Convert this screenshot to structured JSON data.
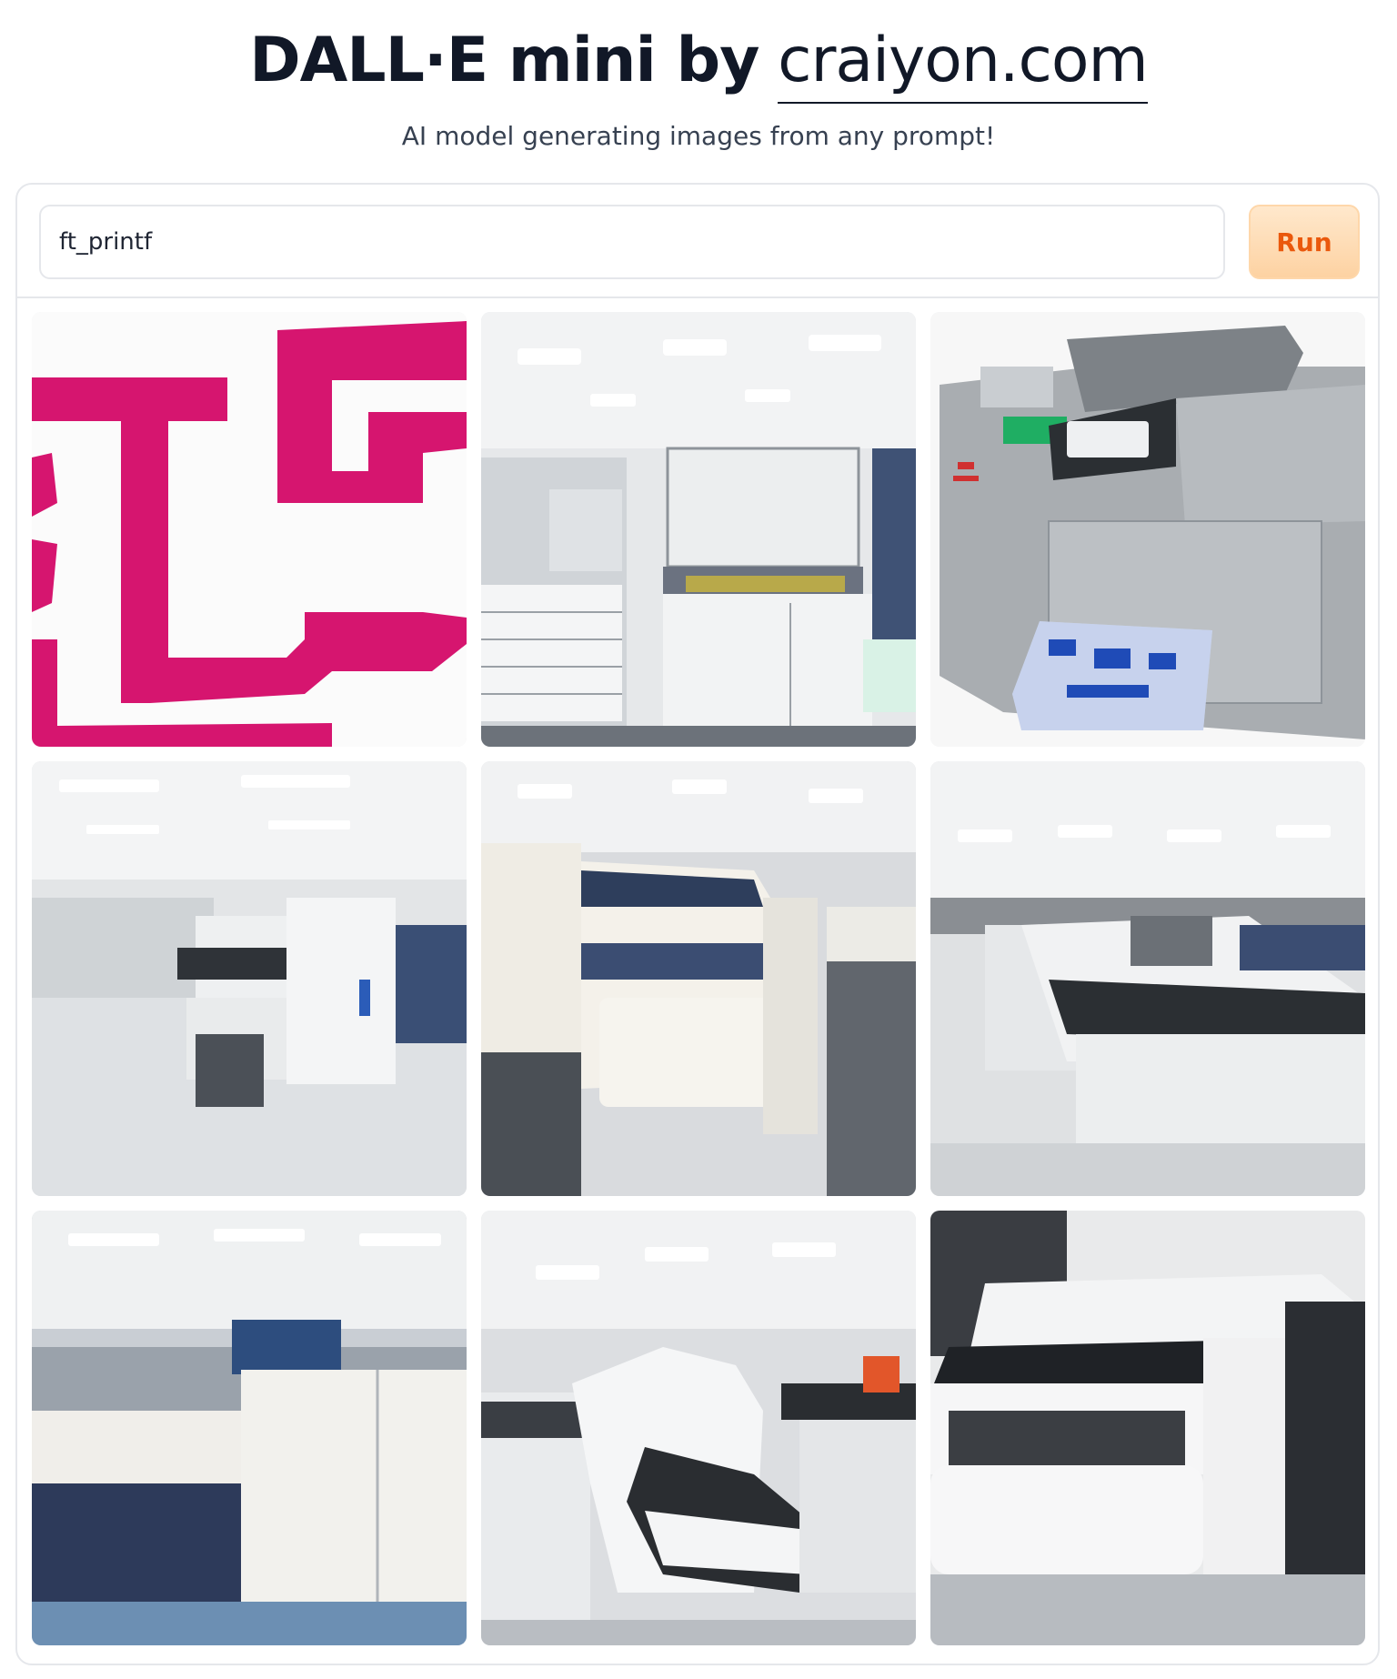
{
  "header": {
    "title_bold": "DALL·E mini by",
    "title_link": "craiyon.com",
    "subtitle": "AI model generating images from any prompt!"
  },
  "prompt": {
    "value": "ft_printf"
  },
  "run_button": {
    "label": "Run"
  },
  "gallery": {
    "items": [
      {
        "scene": "magenta-logo"
      },
      {
        "scene": "printer-room"
      },
      {
        "scene": "desktop-printer"
      },
      {
        "scene": "printer-room"
      },
      {
        "scene": "printer-room"
      },
      {
        "scene": "printer-room"
      },
      {
        "scene": "printer-room"
      },
      {
        "scene": "printer-room"
      },
      {
        "scene": "large-format-printer"
      }
    ]
  },
  "colors": {
    "run_text": "#ea580c",
    "run_bg": "#fdd2a2",
    "logo_magenta": "#d6156f"
  }
}
